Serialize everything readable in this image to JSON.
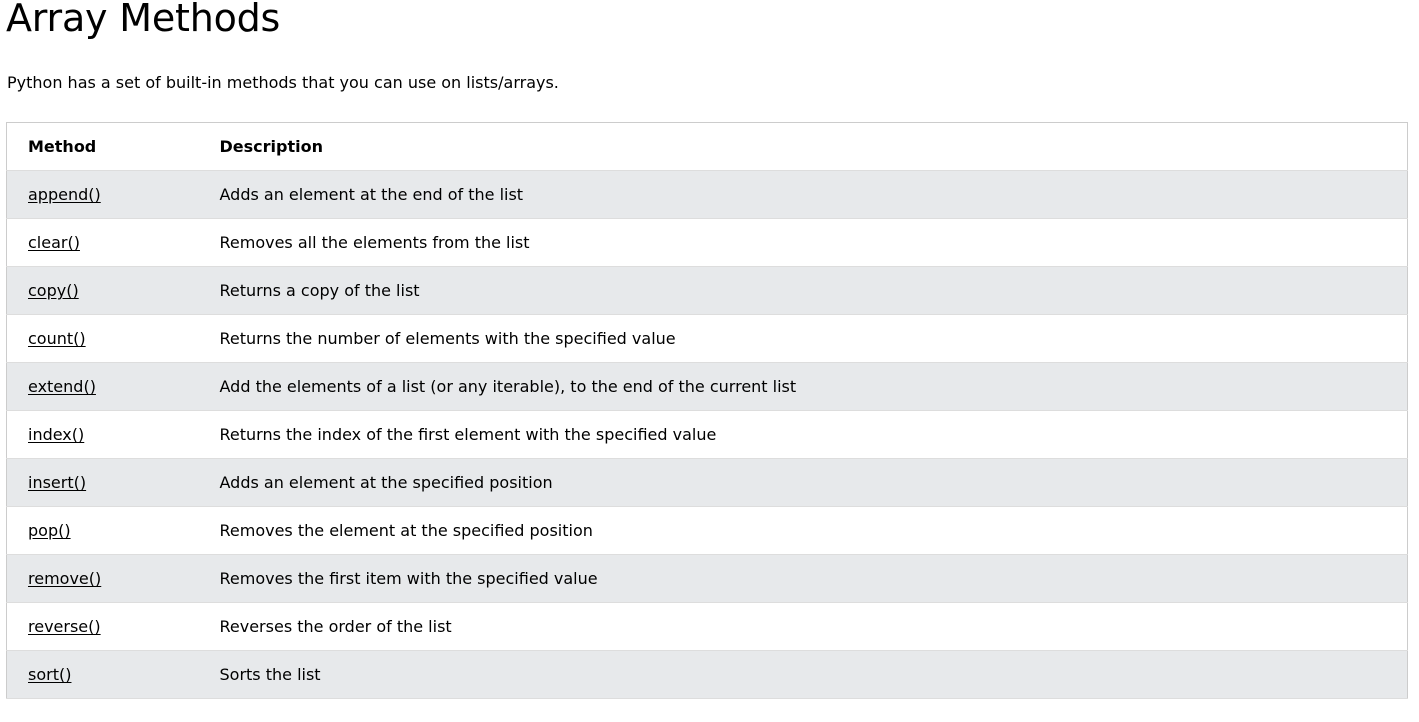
{
  "page": {
    "title": "Array Methods",
    "intro": "Python has a set of built-in methods that you can use on lists/arrays."
  },
  "table": {
    "headers": {
      "method": "Method",
      "description": "Description"
    },
    "rows": [
      {
        "method": "append()",
        "description": "Adds an element at the end of the list"
      },
      {
        "method": "clear()",
        "description": "Removes all the elements from the list"
      },
      {
        "method": "copy()",
        "description": "Returns a copy of the list"
      },
      {
        "method": "count()",
        "description": "Returns the number of elements with the specified value"
      },
      {
        "method": "extend()",
        "description": "Add the elements of a list (or any iterable), to the end of the current list"
      },
      {
        "method": "index()",
        "description": "Returns the index of the first element with the specified value"
      },
      {
        "method": "insert()",
        "description": "Adds an element at the specified position"
      },
      {
        "method": "pop()",
        "description": "Removes the element at the specified position"
      },
      {
        "method": "remove()",
        "description": "Removes the first item with the specified value"
      },
      {
        "method": "reverse()",
        "description": "Reverses the order of the list"
      },
      {
        "method": "sort()",
        "description": "Sorts the list"
      }
    ]
  },
  "colors": {
    "striped_row": "#e7e9eb",
    "border": "#cccccc",
    "text": "#000000"
  }
}
